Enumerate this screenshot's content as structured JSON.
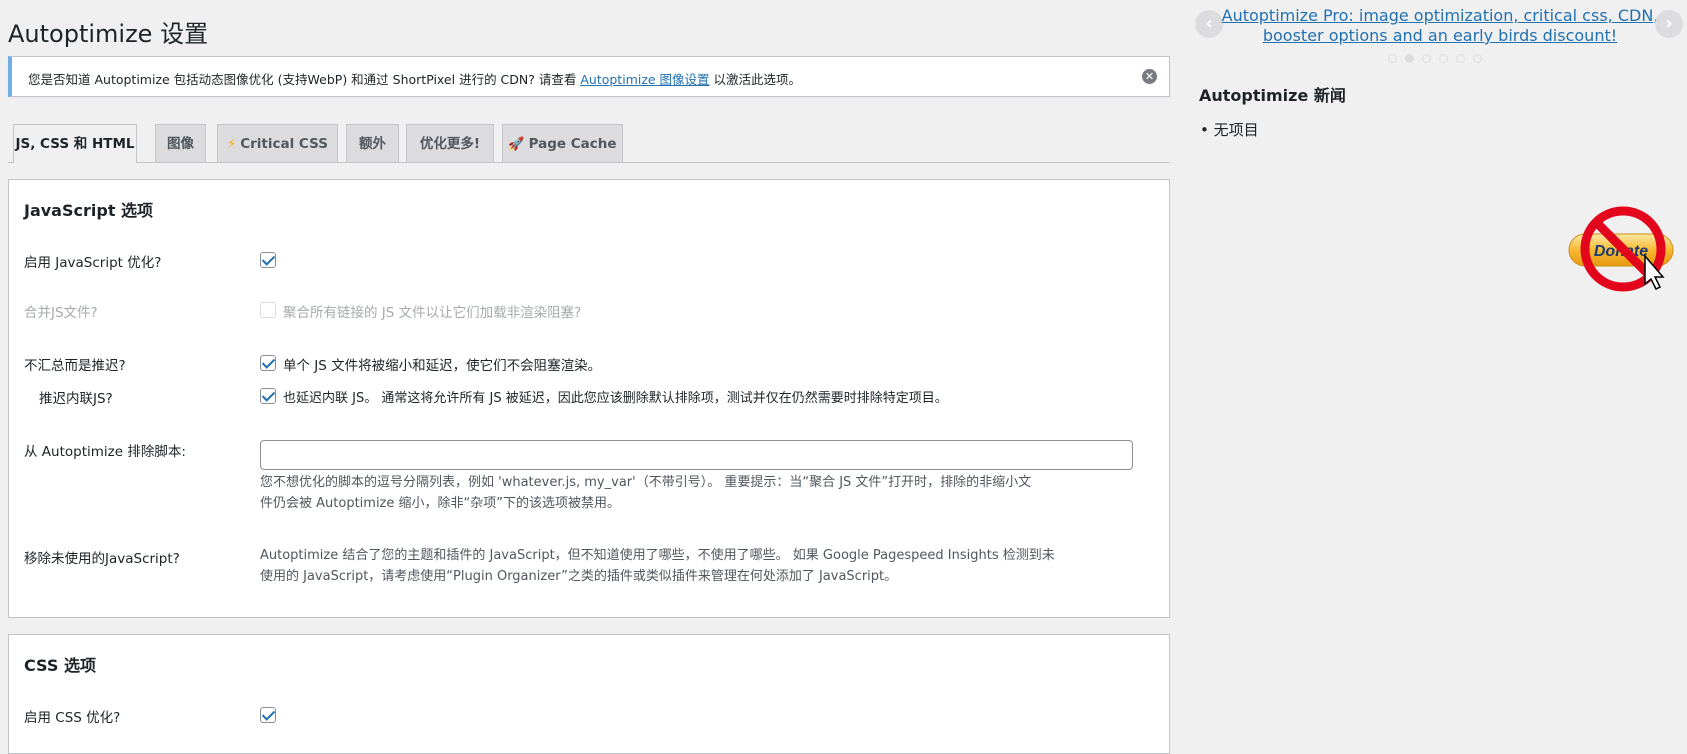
{
  "page_title": "Autoptimize 设置",
  "notice": {
    "text_before": "您是否知道 Autoptimize 包括动态图像优化 (支持WebP) 和通过 ShortPixel 进行的 CDN? 请查看 ",
    "link_text": "Autoptimize 图像设置",
    "text_after": " 以激活此选项。",
    "dismiss_icon": "close-circle-icon"
  },
  "tabs": [
    {
      "label": "JS, CSS 和 HTML",
      "active": true
    },
    {
      "label": "图像",
      "active": false
    },
    {
      "label": "Critical CSS",
      "icon": "⚡",
      "active": false
    },
    {
      "label": "额外",
      "active": false
    },
    {
      "label": "优化更多!",
      "active": false
    },
    {
      "label": "Page Cache",
      "icon": "🚀",
      "active": false
    }
  ],
  "js_section": {
    "title": "JavaScript 选项",
    "rows": {
      "enable_js": {
        "label": "启用 JavaScript 优化?",
        "checked": true
      },
      "aggregate": {
        "label": "合并JS文件?",
        "checkbox_text": "聚合所有链接的 JS 文件以让它们加载非渲染阻塞?",
        "checked": false,
        "disabled": true
      },
      "defer": {
        "label": "不汇总而是推迟?",
        "checkbox_text": "单个 JS 文件将被缩小和延迟，使它们不会阻塞渲染。",
        "checked": true
      },
      "defer_inline": {
        "label": "推迟内联JS?",
        "checkbox_text": "也延迟内联 JS。 通常这将允许所有 JS 被延迟，因此您应该删除默认排除项，测试并仅在仍然需要时排除特定项目。",
        "checked": true
      },
      "exclude": {
        "label": "从 Autoptimize 排除脚本:",
        "value": "",
        "desc_line1": "您不想优化的脚本的逗号分隔列表，例如 'whatever.js, my_var'（不带引号）。 重要提示：当“聚合 JS 文件”打开时，排除的非缩小文",
        "desc_line2": "件仍会被 Autoptimize 缩小，除非“杂项”下的该选项被禁用。"
      },
      "remove_unused": {
        "label": "移除未使用的JavaScript?",
        "desc_line1": "Autoptimize 结合了您的主题和插件的 JavaScript，但不知道使用了哪些，不使用了哪些。 如果 Google Pagespeed Insights 检测到未",
        "desc_line2": "使用的 JavaScript，请考虑使用“Plugin Organizer”之类的插件或类似插件来管理在何处添加了 JavaScript。"
      }
    }
  },
  "css_section": {
    "title": "CSS 选项",
    "rows": {
      "enable_css": {
        "label": "启用 CSS 优化?",
        "checked": true
      }
    }
  },
  "sidebar": {
    "promo": {
      "line1": "Autoptimize Pro: image optimization, critical css, CDN,",
      "line2": "booster options and an early birds discount!"
    },
    "carousel_dots": 6,
    "active_dot": 1,
    "prev_icon": "chevron-left-icon",
    "next_icon": "chevron-right-icon",
    "news_title": "Autoptimize 新闻",
    "news_items": [
      "无项目"
    ],
    "donate_label": "Donate"
  }
}
